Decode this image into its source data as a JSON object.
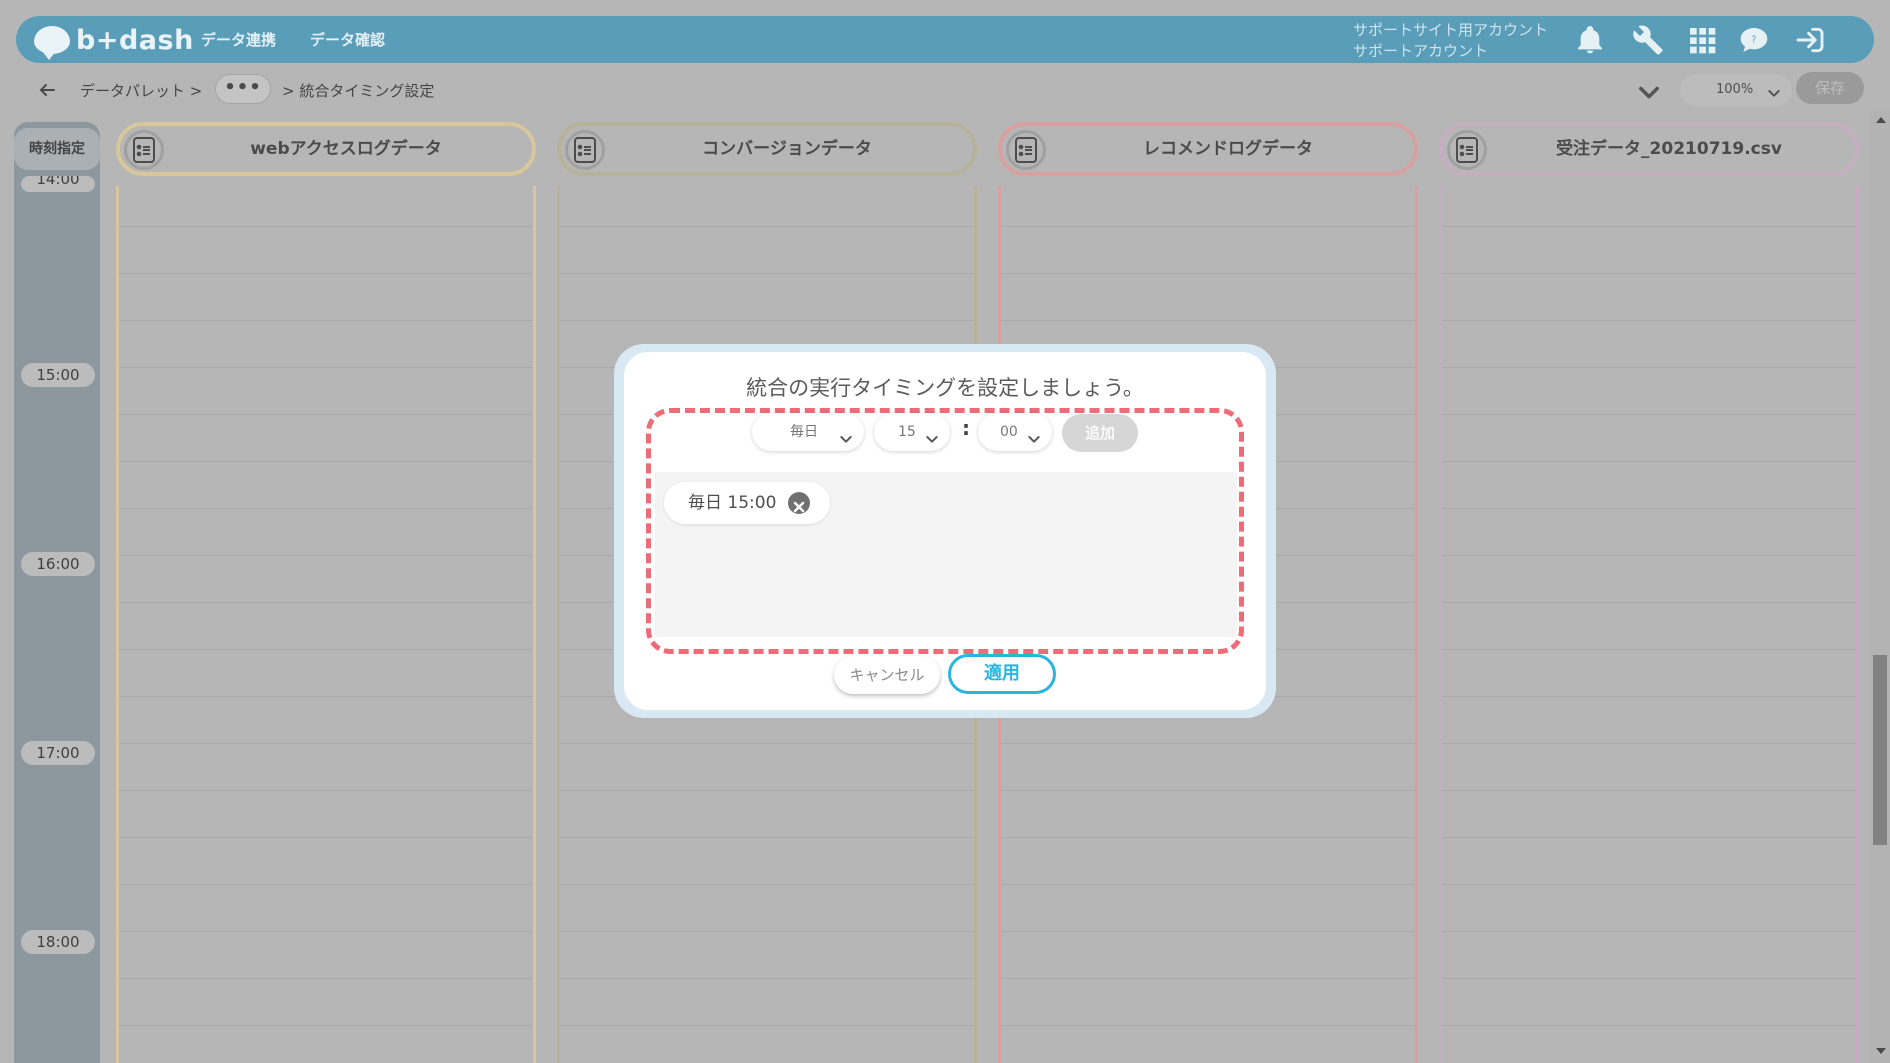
{
  "header": {
    "logo_text": "b+dash",
    "nav": [
      "データ連携",
      "データ確認"
    ],
    "account_line1": "サポートサイト用アカウント",
    "account_line2": "サポートアカウント",
    "icons": [
      "bell-icon",
      "wrench-icon",
      "grid-icon",
      "help-icon",
      "logout-icon"
    ]
  },
  "breadcrumb": {
    "first": "データパレット >",
    "more": "•••",
    "current": "> 統合タイミング設定",
    "zoom_value": "100%",
    "save_label": "保存"
  },
  "timeline": {
    "header_label": "時刻指定",
    "partial_label": "14:00",
    "labels": [
      "15:00",
      "16:00",
      "17:00",
      "18:00"
    ]
  },
  "columns": [
    {
      "title": "webアクセスログデータ",
      "color": "#d8c79a"
    },
    {
      "title": "コンバージョンデータ",
      "color": "#b7b29a"
    },
    {
      "title": "レコメンドログデータ",
      "color": "#d9a0a0"
    },
    {
      "title": "受注データ_20210719.csv",
      "color": "#c4aebf"
    }
  ],
  "modal": {
    "title": "統合の実行タイミングを設定しましょう。",
    "frequency_value": "毎日",
    "hour_value": "15",
    "colon": ":",
    "minute_value": "00",
    "add_label": "追加",
    "schedules": [
      "毎日 15:00"
    ],
    "cancel_label": "キャンセル",
    "apply_label": "適用",
    "highlight_color": "#ee6c78",
    "accent_color": "#27b6e0"
  }
}
